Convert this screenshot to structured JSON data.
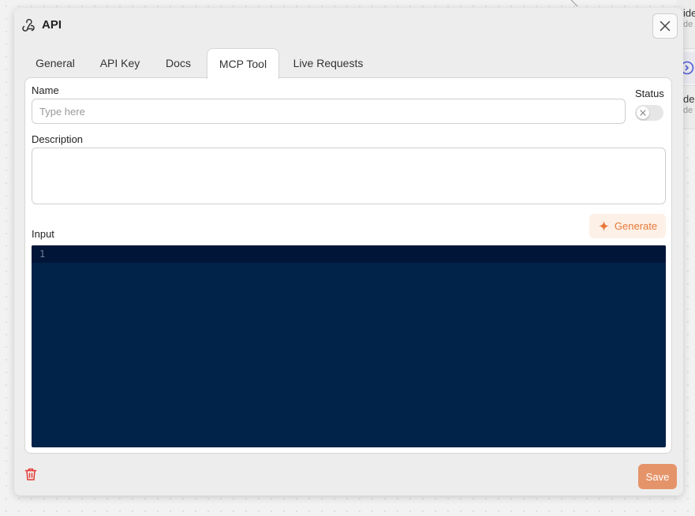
{
  "background": {
    "node_title": "ide",
    "node_sub": "de",
    "node2_title": "de",
    "node2_sub": "de"
  },
  "modal": {
    "title": "API",
    "icon": "webhook-icon"
  },
  "tabs": [
    {
      "label": "General",
      "active": false
    },
    {
      "label": "API Key",
      "active": false
    },
    {
      "label": "Docs",
      "active": false
    },
    {
      "label": "MCP Tool",
      "active": true
    },
    {
      "label": "Live Requests",
      "active": false
    }
  ],
  "form": {
    "name_label": "Name",
    "name_placeholder": "Type here",
    "name_value": "",
    "status_label": "Status",
    "status_on": false,
    "description_label": "Description",
    "description_value": "",
    "input_label": "Input",
    "generate_label": "Generate",
    "editor_line_number": "1"
  },
  "footer": {
    "save_label": "Save"
  },
  "colors": {
    "accent": "#e8793a",
    "save_button": "#e5946a",
    "editor_bg": "#012249",
    "delete_icon": "#e53935"
  }
}
